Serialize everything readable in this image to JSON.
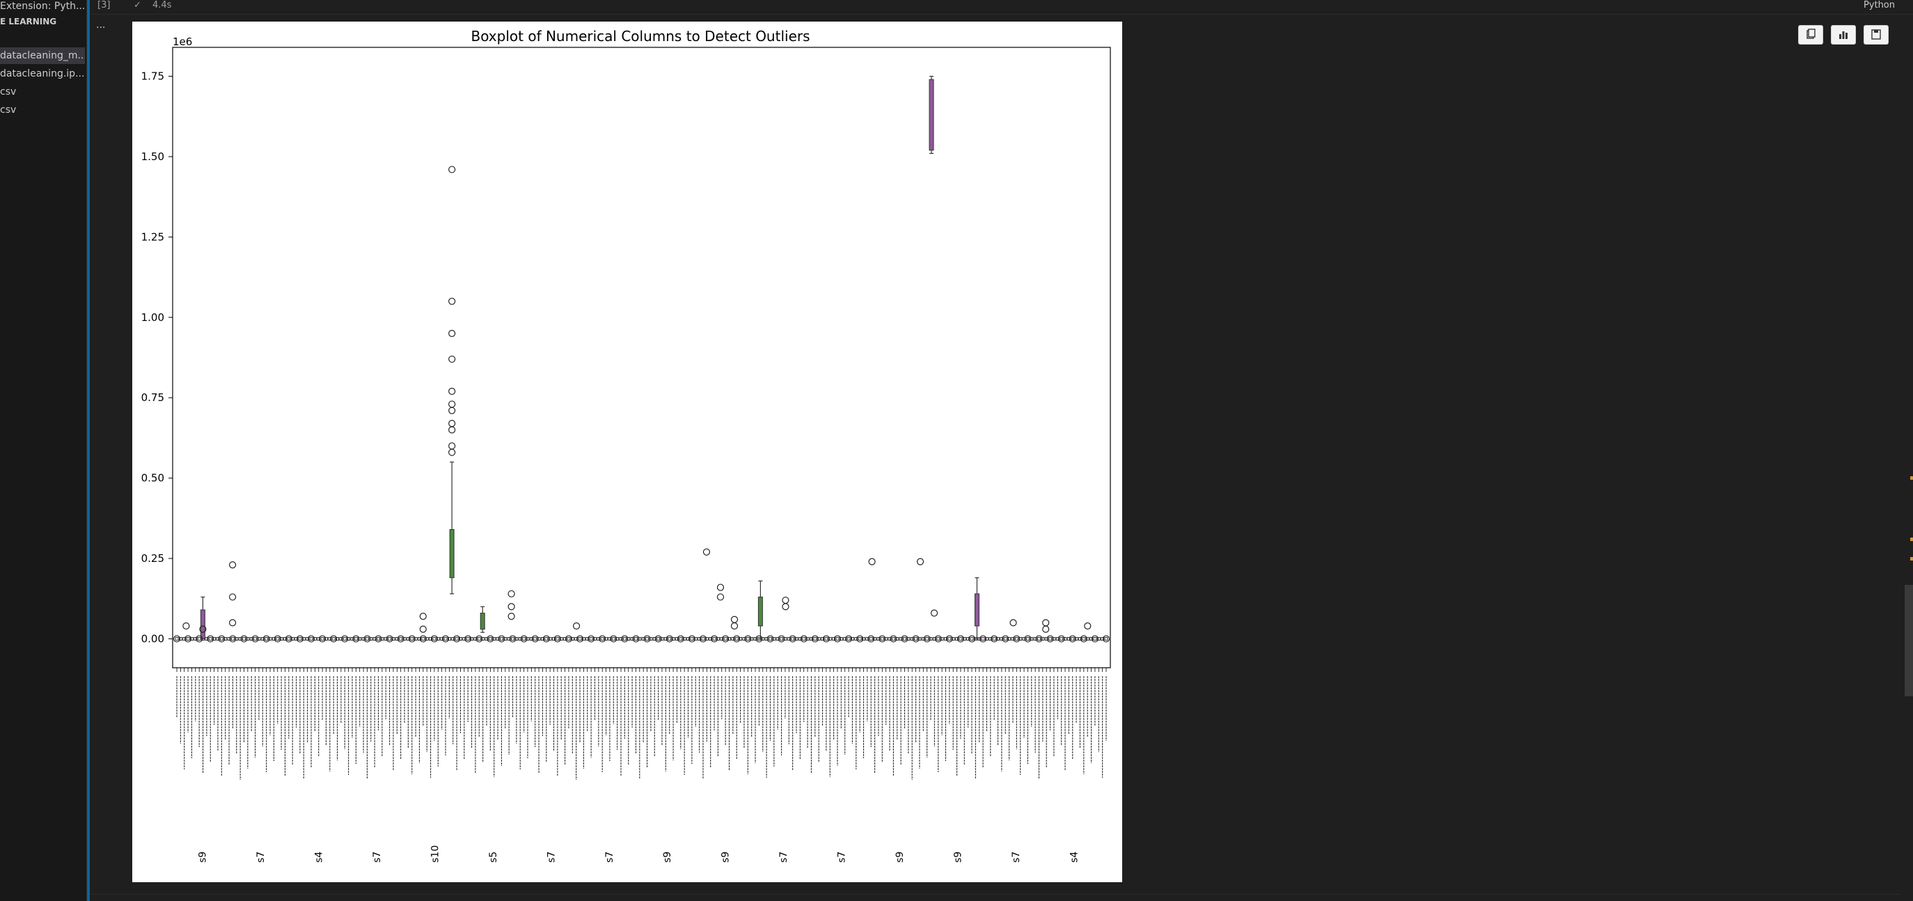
{
  "sidebar": {
    "extension_label": "Extension: Pyth...",
    "section_header": "E LEARNING",
    "files": [
      {
        "label": "datacleaning_m...",
        "active": true
      },
      {
        "label": "datacleaning.ip...",
        "active": false
      },
      {
        "label": "csv",
        "active": false
      },
      {
        "label": "csv",
        "active": false
      }
    ]
  },
  "cell": {
    "execution_count": "[3]",
    "status_icon": "check-icon",
    "duration": "4.4s",
    "kernel": "Python",
    "more": "..."
  },
  "output_toolbar": {
    "icons": [
      "copy-icon",
      "chart-icon",
      "save-icon"
    ]
  },
  "colors": {
    "box_green": "#4c8a3a",
    "box_purple": "#8e5a9a"
  },
  "chart_data": {
    "type": "box",
    "title": "Boxplot of Numerical Columns to Detect Outliers",
    "y_multiplier_label": "1e6",
    "yticks": [
      "0.00",
      "0.25",
      "0.50",
      "0.75",
      "1.00",
      "1.25",
      "1.50",
      "1.75"
    ],
    "ylim": [
      -0.09,
      1.84
    ],
    "x_tick_label_samples": [
      "s9",
      "s7",
      "s4",
      "s7",
      "s10",
      "s5",
      "s7",
      "s7",
      "s9",
      "s9",
      "s7",
      "s7",
      "s9",
      "s9",
      "s7",
      "s4"
    ],
    "num_columns": 250,
    "notable_boxes": [
      {
        "x_frac": 0.296,
        "q1": 0.19,
        "q3": 0.34,
        "whisker_low": 0.14,
        "whisker_high": 0.55,
        "color": "green",
        "outliers": [
          0.58,
          0.6,
          0.65,
          0.67,
          0.71,
          0.73,
          0.77,
          0.87,
          0.95,
          1.05,
          1.46
        ]
      },
      {
        "x_frac": 0.329,
        "q1": 0.03,
        "q3": 0.08,
        "whisker_low": 0.02,
        "whisker_high": 0.1,
        "color": "green",
        "outliers": []
      },
      {
        "x_frac": 0.028,
        "q1": 0.0,
        "q3": 0.09,
        "whisker_low": 0.0,
        "whisker_high": 0.13,
        "color": "purple",
        "outliers": [
          0.03
        ]
      },
      {
        "x_frac": 0.628,
        "q1": 0.04,
        "q3": 0.13,
        "whisker_low": 0.0,
        "whisker_high": 0.18,
        "color": "green",
        "outliers": []
      },
      {
        "x_frac": 0.812,
        "q1": 1.52,
        "q3": 1.74,
        "whisker_low": 1.51,
        "whisker_high": 1.75,
        "color": "purple",
        "outliers": []
      },
      {
        "x_frac": 0.861,
        "q1": 0.04,
        "q3": 0.14,
        "whisker_low": 0.0,
        "whisker_high": 0.19,
        "color": "purple",
        "outliers": []
      }
    ],
    "scattered_outliers": [
      {
        "x_frac": 0.06,
        "y": 0.23
      },
      {
        "x_frac": 0.06,
        "y": 0.13
      },
      {
        "x_frac": 0.06,
        "y": 0.05
      },
      {
        "x_frac": 0.01,
        "y": 0.04
      },
      {
        "x_frac": 0.265,
        "y": 0.07
      },
      {
        "x_frac": 0.265,
        "y": 0.03
      },
      {
        "x_frac": 0.36,
        "y": 0.14
      },
      {
        "x_frac": 0.36,
        "y": 0.1
      },
      {
        "x_frac": 0.36,
        "y": 0.07
      },
      {
        "x_frac": 0.43,
        "y": 0.04
      },
      {
        "x_frac": 0.57,
        "y": 0.27
      },
      {
        "x_frac": 0.585,
        "y": 0.16
      },
      {
        "x_frac": 0.585,
        "y": 0.13
      },
      {
        "x_frac": 0.6,
        "y": 0.06
      },
      {
        "x_frac": 0.6,
        "y": 0.04
      },
      {
        "x_frac": 0.655,
        "y": 0.12
      },
      {
        "x_frac": 0.655,
        "y": 0.1
      },
      {
        "x_frac": 0.748,
        "y": 0.24
      },
      {
        "x_frac": 0.8,
        "y": 0.24
      },
      {
        "x_frac": 0.815,
        "y": 0.08
      },
      {
        "x_frac": 0.9,
        "y": 0.05
      },
      {
        "x_frac": 0.935,
        "y": 0.05
      },
      {
        "x_frac": 0.935,
        "y": 0.03
      },
      {
        "x_frac": 0.98,
        "y": 0.04
      }
    ]
  }
}
